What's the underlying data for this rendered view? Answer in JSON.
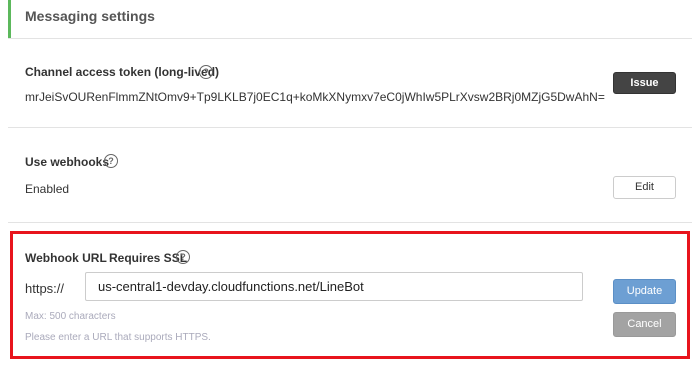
{
  "header": {
    "title": "Messaging settings"
  },
  "channel_token": {
    "label": "Channel access token (long-lived)",
    "value": "mrJeiSvOURenFlmmZNtOmv9+Tp9LKLB7j0EC1q+koMkXNymxv7eC0jWhIw5PLrXvsw2BRj0MZjG5DwAhN=",
    "issue_label": "Issue"
  },
  "webhooks": {
    "label": "Use webhooks",
    "status": "Enabled",
    "edit_label": "Edit"
  },
  "webhook_url": {
    "label": "Webhook URL",
    "ssl_label": "Requires SSL",
    "scheme": "https://",
    "value": "us-central1-devday.cloudfunctions.net/LineBot",
    "max_hint": "Max: 500 characters",
    "https_hint": "Please enter a URL that supports HTTPS.",
    "update_label": "Update",
    "cancel_label": "Cancel"
  },
  "help_glyph": "?",
  "colors": {
    "accent_bar": "#5cb85c",
    "highlight_border": "#e8141c",
    "update_button": "#6d9fd3",
    "cancel_button": "#a3a3a3",
    "issue_button": "#444444"
  }
}
